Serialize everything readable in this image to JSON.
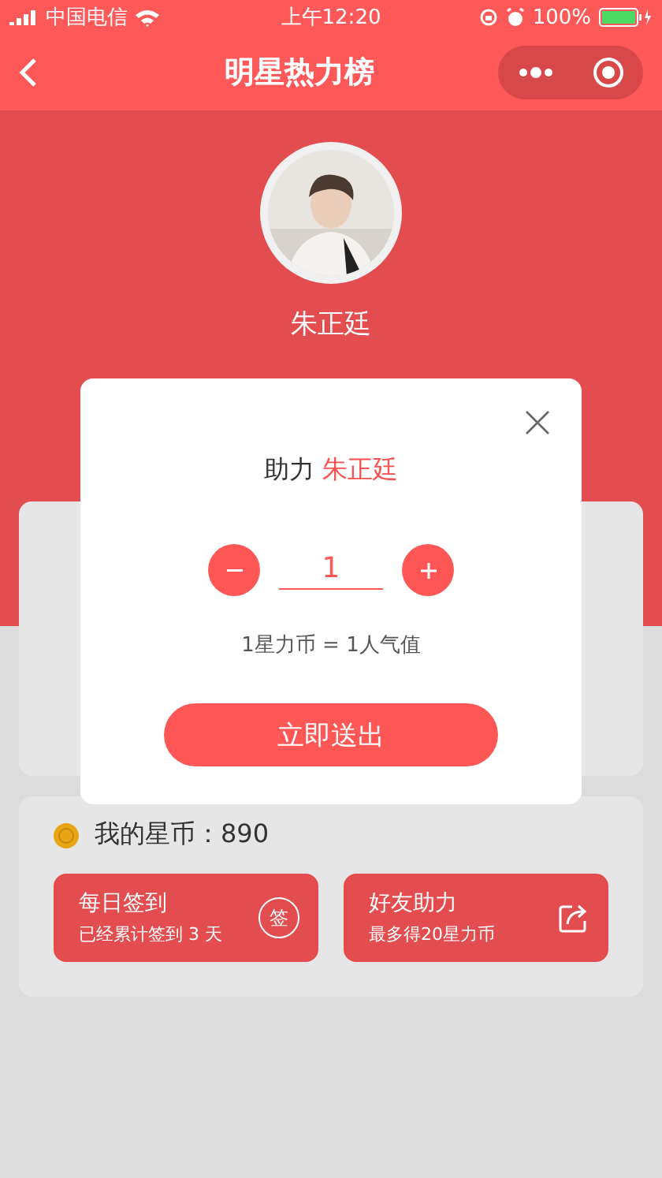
{
  "status_bar": {
    "carrier": "中国电信",
    "time": "上午12:20",
    "battery": "100%"
  },
  "nav": {
    "title": "明星热力榜"
  },
  "profile": {
    "name": "朱正廷"
  },
  "dialog": {
    "prefix": "助力",
    "star_name": "朱正廷",
    "quantity": "1",
    "rate": "1星力币 = 1人气值",
    "submit": "立即送出"
  },
  "wallet": {
    "label": "我的星币：890"
  },
  "tasks": [
    {
      "kind": "checkin",
      "title": "每日签到",
      "subtitle": "已经累计签到 3 天",
      "badge": "签"
    },
    {
      "kind": "share",
      "title": "好友助力",
      "subtitle": "最多得20星力币"
    }
  ]
}
